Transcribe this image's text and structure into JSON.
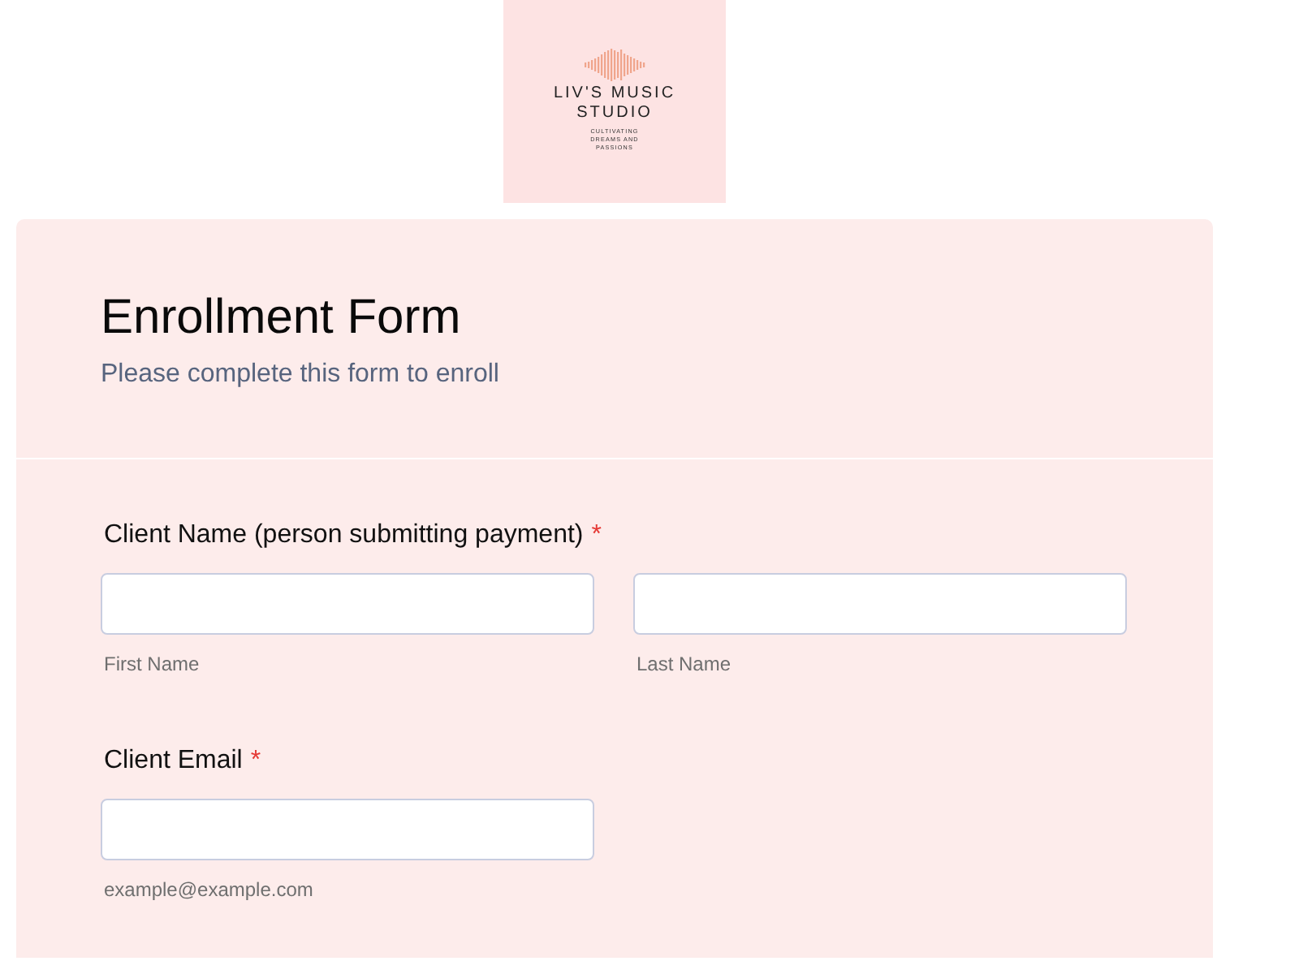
{
  "logo": {
    "title": "LIV'S MUSIC STUDIO",
    "tagline": "CULTIVATING DREAMS AND PASSIONS"
  },
  "form": {
    "title": "Enrollment Form",
    "subtitle": "Please complete this form to enroll",
    "questions": [
      {
        "label": "Client Name (person submitting payment)",
        "required_mark": "*",
        "fields": [
          {
            "sublabel": "First Name"
          },
          {
            "sublabel": "Last Name"
          }
        ]
      },
      {
        "label": "Client Email",
        "required_mark": "*",
        "fields": [
          {
            "sublabel": "example@example.com"
          }
        ]
      }
    ]
  }
}
